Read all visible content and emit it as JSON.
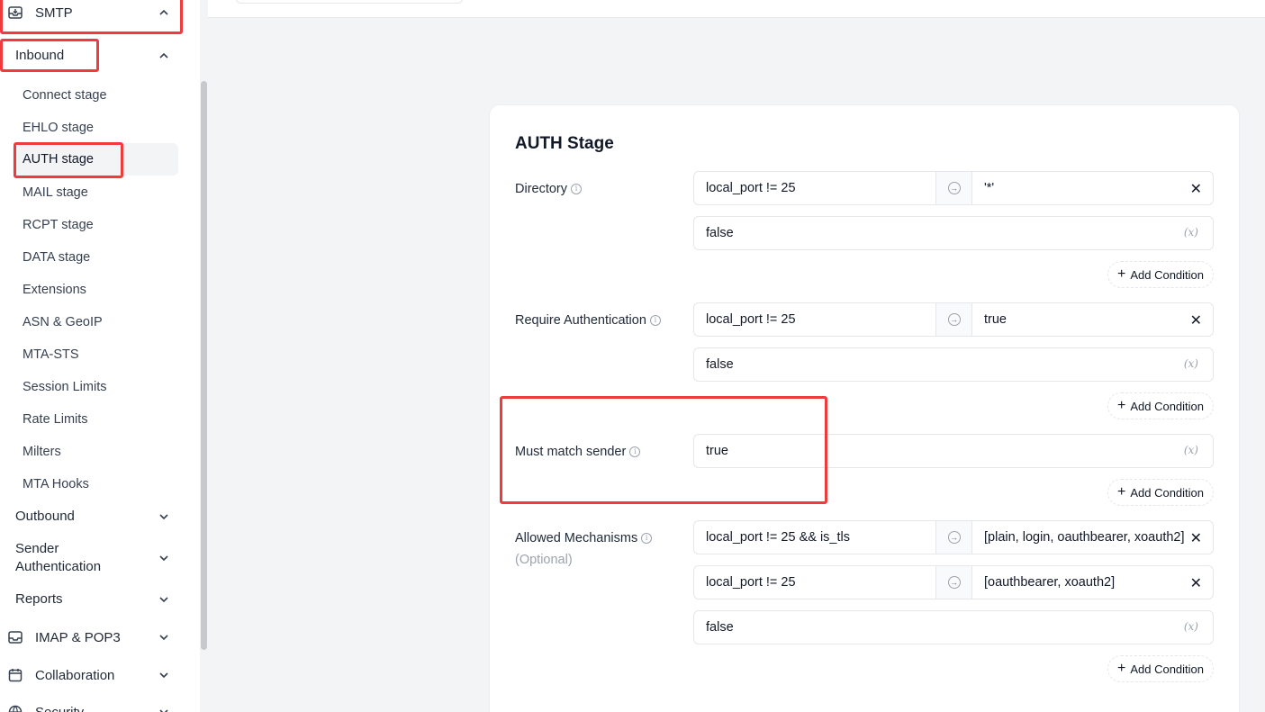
{
  "sidebar": {
    "smtp": "SMTP",
    "inbound": "Inbound",
    "inbound_items": [
      "Connect stage",
      "EHLO stage",
      "AUTH stage",
      "MAIL stage",
      "RCPT stage",
      "DATA stage",
      "Extensions",
      "ASN & GeoIP",
      "MTA-STS",
      "Session Limits",
      "Rate Limits",
      "Milters",
      "MTA Hooks"
    ],
    "outbound": "Outbound",
    "sender_auth": "Sender Authentication",
    "reports": "Reports",
    "imap": "IMAP & POP3",
    "collaboration": "Collaboration",
    "security": "Security"
  },
  "card": {
    "title": "AUTH Stage",
    "add_condition": "Add Condition",
    "directory": {
      "label": "Directory",
      "conditions": [
        {
          "if": "local_port != 25",
          "then": "'*'"
        }
      ],
      "default": "false"
    },
    "require_auth": {
      "label": "Require Authentication",
      "conditions": [
        {
          "if": "local_port != 25",
          "then": "true"
        }
      ],
      "default": "false"
    },
    "must_match": {
      "label": "Must match sender",
      "default": "true"
    },
    "mechanisms": {
      "label": "Allowed Mechanisms",
      "sublabel": "(Optional)",
      "conditions": [
        {
          "if": "local_port != 25 && is_tls",
          "then": "[plain, login, oauthbearer, xoauth2]"
        },
        {
          "if": "local_port != 25",
          "then": "[oauthbearer, xoauth2]"
        }
      ],
      "default": "false"
    }
  },
  "icons": {
    "info": "info-icon",
    "arrow": "arrow-right-circle-icon",
    "remove": "close-icon",
    "variable": "variable-icon",
    "add": "plus-icon"
  },
  "colors": {
    "highlight": "#ef3b3b",
    "active_bg": "#f3f4f6",
    "main_bg": "#f3f4f6"
  }
}
